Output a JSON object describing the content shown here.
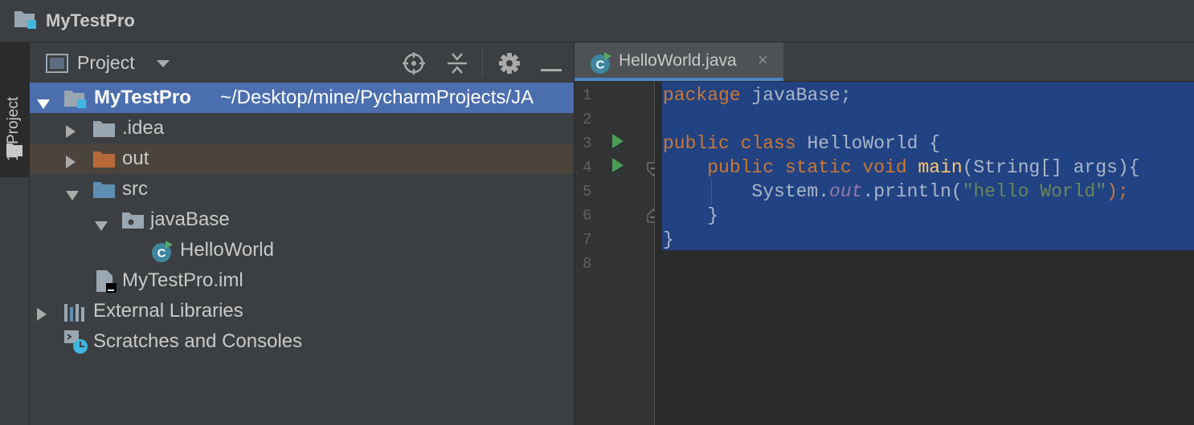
{
  "title_bar": {
    "project_name": "MyTestPro"
  },
  "side_tool_window": {
    "label": "1: Project"
  },
  "project_panel": {
    "title": "Project",
    "toolbar_icons": [
      "locate-icon",
      "collapse-all-icon",
      "gear-icon",
      "hide-icon"
    ],
    "tree": [
      {
        "label": "MyTestPro",
        "path": "~/Desktop/mine/PycharmProjects/JA",
        "icon": "module-icon",
        "selected": true
      },
      {
        "label": ".idea",
        "icon": "folder-icon"
      },
      {
        "label": "out",
        "icon": "folder-orange-icon"
      },
      {
        "label": "src",
        "icon": "folder-blue-icon"
      },
      {
        "label": "javaBase",
        "icon": "package-icon"
      },
      {
        "label": "HelloWorld",
        "icon": "java-class-icon"
      },
      {
        "label": "MyTestPro.iml",
        "icon": "iml-file-icon"
      },
      {
        "label": "External Libraries",
        "icon": "libraries-icon"
      },
      {
        "label": "Scratches and Consoles",
        "icon": "scratches-icon"
      }
    ]
  },
  "editor": {
    "tabs": [
      {
        "label": "HelloWorld.java",
        "close": "×",
        "icon": "java-class-icon"
      }
    ],
    "line_numbers": [
      "1",
      "2",
      "3",
      "4",
      "5",
      "6",
      "7",
      "8"
    ],
    "code": {
      "l1_kw": "package",
      "l1_rest": " javaBase;",
      "l3_kw1": "public",
      "l3_kw2": "class",
      "l3_rest": " HelloWorld {",
      "l4_indent": "    ",
      "l4_kw": "public static void",
      "l4_fn": "main",
      "l4_rest": "(String[] args){",
      "l5_pre": "        System.",
      "l5_field": "out",
      "l5_mid": ".println(",
      "l5_str": "\"hello World\"",
      "l5_end": ");",
      "l6": "    }",
      "l7": "}"
    }
  },
  "colors": {
    "selection": "#214283",
    "tree_selected": "#4b6eaf",
    "keyword": "#cc7832",
    "string": "#6a8759",
    "method": "#ffc66d"
  }
}
